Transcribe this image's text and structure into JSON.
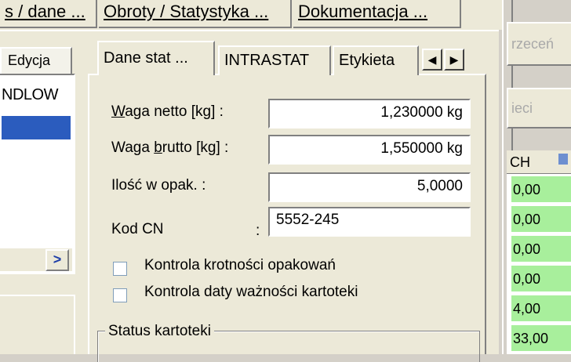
{
  "top_tabs": [
    {
      "label": "s / dane ..."
    },
    {
      "label": "Obroty / Statystyka ..."
    },
    {
      "label": "Dokumentacja ..."
    }
  ],
  "left_panel": {
    "tab_label": "Edycja",
    "list_header": "NDLOW",
    "scroll_right_icon": "arrow-right-icon"
  },
  "inner_tabs": {
    "items": [
      {
        "label": "Dane stat ...",
        "active": true
      },
      {
        "label": "INTRASTAT",
        "active": false
      },
      {
        "label": "Etykieta",
        "active": false
      }
    ],
    "prev_icon": "◀",
    "next_icon": "▶"
  },
  "form": {
    "waga_netto": {
      "label_underlined": "W",
      "label_rest": "aga  netto [kg]  :",
      "value": "1,230000 kg"
    },
    "waga_brutto": {
      "label_pre": "Waga ",
      "label_underlined": "b",
      "label_rest": "rutto [kg] :",
      "value": "1,550000 kg"
    },
    "ilosc": {
      "label": "Ilość w opak.    :",
      "value": "5,0000"
    },
    "kod_cn": {
      "label": "Kod CN",
      "colon": ":",
      "value": "5552-245"
    },
    "checkbox_krotnosci": {
      "label": "Kontrola krotności opakowań",
      "checked": false
    },
    "checkbox_daty": {
      "label": "Kontrola daty ważności kartoteki",
      "checked": false
    },
    "group_label": "Status kartoteki"
  },
  "right_side": {
    "button_top": "rzeceń",
    "button_mid": "ieci",
    "grid_header": "CH",
    "cells": [
      "0,00",
      "0,00",
      "0,00",
      "0,00",
      "4,00",
      "33,00"
    ],
    "cell_color": "#a8ef9c"
  }
}
